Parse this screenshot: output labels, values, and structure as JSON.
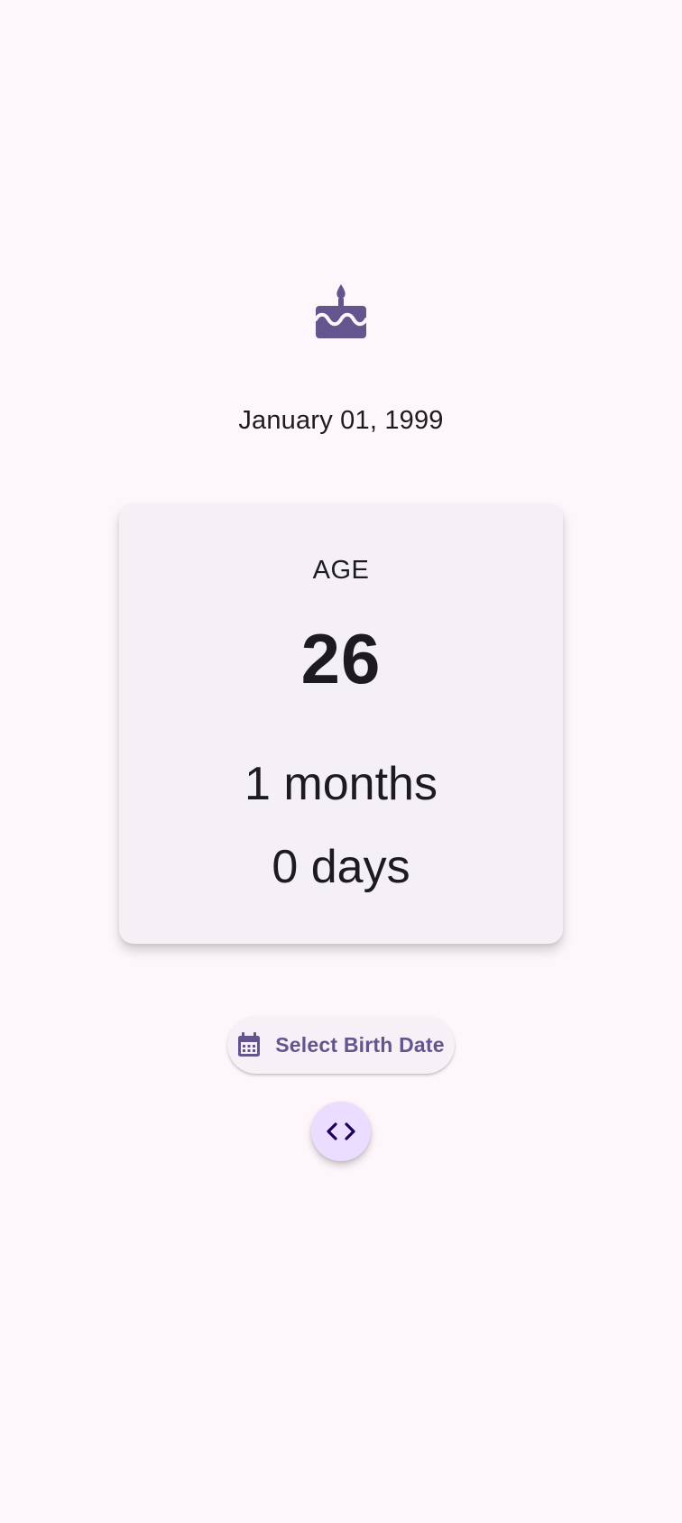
{
  "colors": {
    "background": "#FDF7FC",
    "primary": "#65558F",
    "card": "#F5F0F6",
    "fab": "#EADDFF",
    "text": "#1D1B20"
  },
  "header": {
    "icon": "cake-icon",
    "birth_date": "January 01, 1999"
  },
  "age_card": {
    "label": "AGE",
    "years": "26",
    "months": "1 months",
    "days": "0 days"
  },
  "actions": {
    "select_birth_date_label": "Select Birth Date",
    "select_birth_date_icon": "calendar-icon",
    "code_fab_icon": "code-icon"
  }
}
